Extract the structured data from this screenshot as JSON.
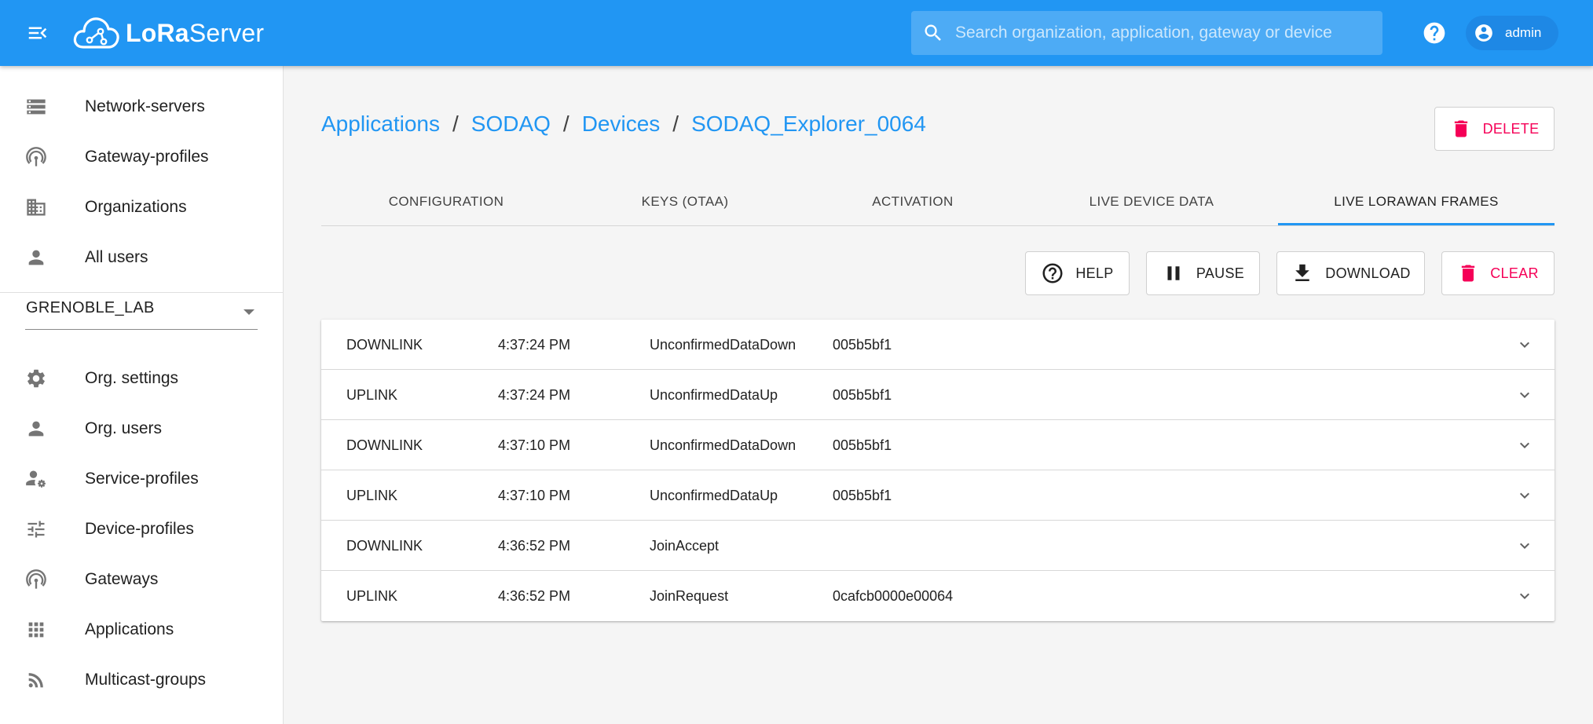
{
  "app": {
    "logo_bold": "LoRa",
    "logo_light": "Server"
  },
  "topbar": {
    "search_placeholder": "Search organization, application, gateway or device",
    "username": "admin"
  },
  "sidebar": {
    "admin_items": [
      {
        "label": "Network-servers",
        "icon": "server-icon"
      },
      {
        "label": "Gateway-profiles",
        "icon": "antenna-icon"
      },
      {
        "label": "Organizations",
        "icon": "building-icon"
      },
      {
        "label": "All users",
        "icon": "person-icon"
      }
    ],
    "org_selected": "GRENOBLE_LAB",
    "org_items": [
      {
        "label": "Org. settings",
        "icon": "gear-icon"
      },
      {
        "label": "Org. users",
        "icon": "person-icon"
      },
      {
        "label": "Service-profiles",
        "icon": "person-settings-icon"
      },
      {
        "label": "Device-profiles",
        "icon": "tune-icon"
      },
      {
        "label": "Gateways",
        "icon": "antenna-icon"
      },
      {
        "label": "Applications",
        "icon": "apps-grid-icon"
      },
      {
        "label": "Multicast-groups",
        "icon": "rss-icon"
      }
    ]
  },
  "breadcrumb": [
    "Applications",
    "SODAQ",
    "Devices",
    "SODAQ_Explorer_0064"
  ],
  "header_actions": {
    "delete_label": "DELETE"
  },
  "tabs": [
    {
      "label": "CONFIGURATION",
      "active": false
    },
    {
      "label": "KEYS (OTAA)",
      "active": false
    },
    {
      "label": "ACTIVATION",
      "active": false
    },
    {
      "label": "LIVE DEVICE DATA",
      "active": false
    },
    {
      "label": "LIVE LORAWAN FRAMES",
      "active": true
    }
  ],
  "frame_actions": {
    "help_label": "HELP",
    "pause_label": "PAUSE",
    "download_label": "DOWNLOAD",
    "clear_label": "CLEAR"
  },
  "frames": [
    {
      "direction": "DOWNLINK",
      "time": "4:37:24 PM",
      "type": "UnconfirmedDataDown",
      "addr": "005b5bf1"
    },
    {
      "direction": "UPLINK",
      "time": "4:37:24 PM",
      "type": "UnconfirmedDataUp",
      "addr": "005b5bf1"
    },
    {
      "direction": "DOWNLINK",
      "time": "4:37:10 PM",
      "type": "UnconfirmedDataDown",
      "addr": "005b5bf1"
    },
    {
      "direction": "UPLINK",
      "time": "4:37:10 PM",
      "type": "UnconfirmedDataUp",
      "addr": "005b5bf1"
    },
    {
      "direction": "DOWNLINK",
      "time": "4:36:52 PM",
      "type": "JoinAccept",
      "addr": ""
    },
    {
      "direction": "UPLINK",
      "time": "4:36:52 PM",
      "type": "JoinRequest",
      "addr": "0cafcb0000e00064"
    }
  ],
  "colors": {
    "primary": "#2196f3",
    "accent_danger": "#f50057",
    "background": "#f5f5f5"
  }
}
